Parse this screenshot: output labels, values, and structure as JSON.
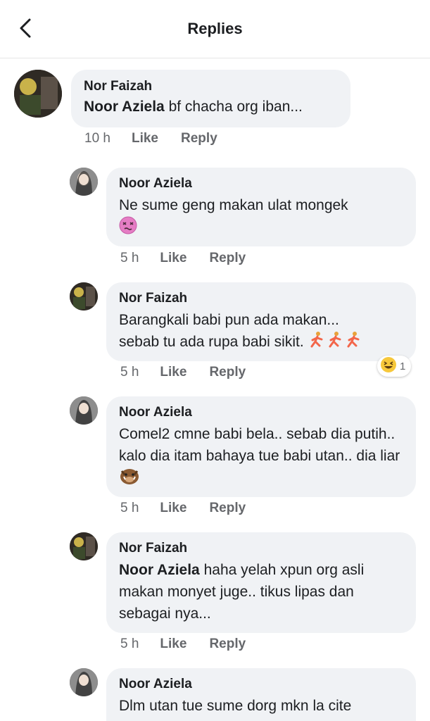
{
  "header": {
    "title": "Replies",
    "back_icon": "chevron-left-icon"
  },
  "actions": {
    "like": "Like",
    "reply": "Reply"
  },
  "comments": [
    {
      "author": "Nor Faizah",
      "mention": "Noor Aziela",
      "text": " bf chacha org iban...",
      "time": "10 h"
    },
    {
      "author": "Noor Aziela",
      "text": "Ne sume geng makan ulat mongek",
      "emoji": "dizzy-face-emoji",
      "time": "5 h"
    },
    {
      "author": "Nor Faizah",
      "text_line1": "Barangkali babi pun ada makan...",
      "text_line2": "sebab tu ada rupa babi sikit. ",
      "emoji": "running-man-emoji",
      "time": "5 h",
      "reaction": {
        "icon": "haha-reaction-icon",
        "count": "1"
      }
    },
    {
      "author": "Noor Aziela",
      "text": "Comel2 cmne babi bela.. sebab dia putih.. kalo dia itam bahaya tue babi utan.. dia liar ",
      "emoji": "boar-emoji",
      "time": "5 h"
    },
    {
      "author": "Nor Faizah",
      "mention": "Noor Aziela",
      "text": " haha yelah xpun org asli makan monyet juge.. tikus lipas dan sebagai nya...",
      "time": "5 h"
    },
    {
      "author": "Noor Aziela",
      "text": "Dlm utan tue sume dorg mkn la cite"
    }
  ],
  "colors": {
    "bubble": "#f0f2f5",
    "meta": "#65676b",
    "text": "#1c1e21"
  }
}
